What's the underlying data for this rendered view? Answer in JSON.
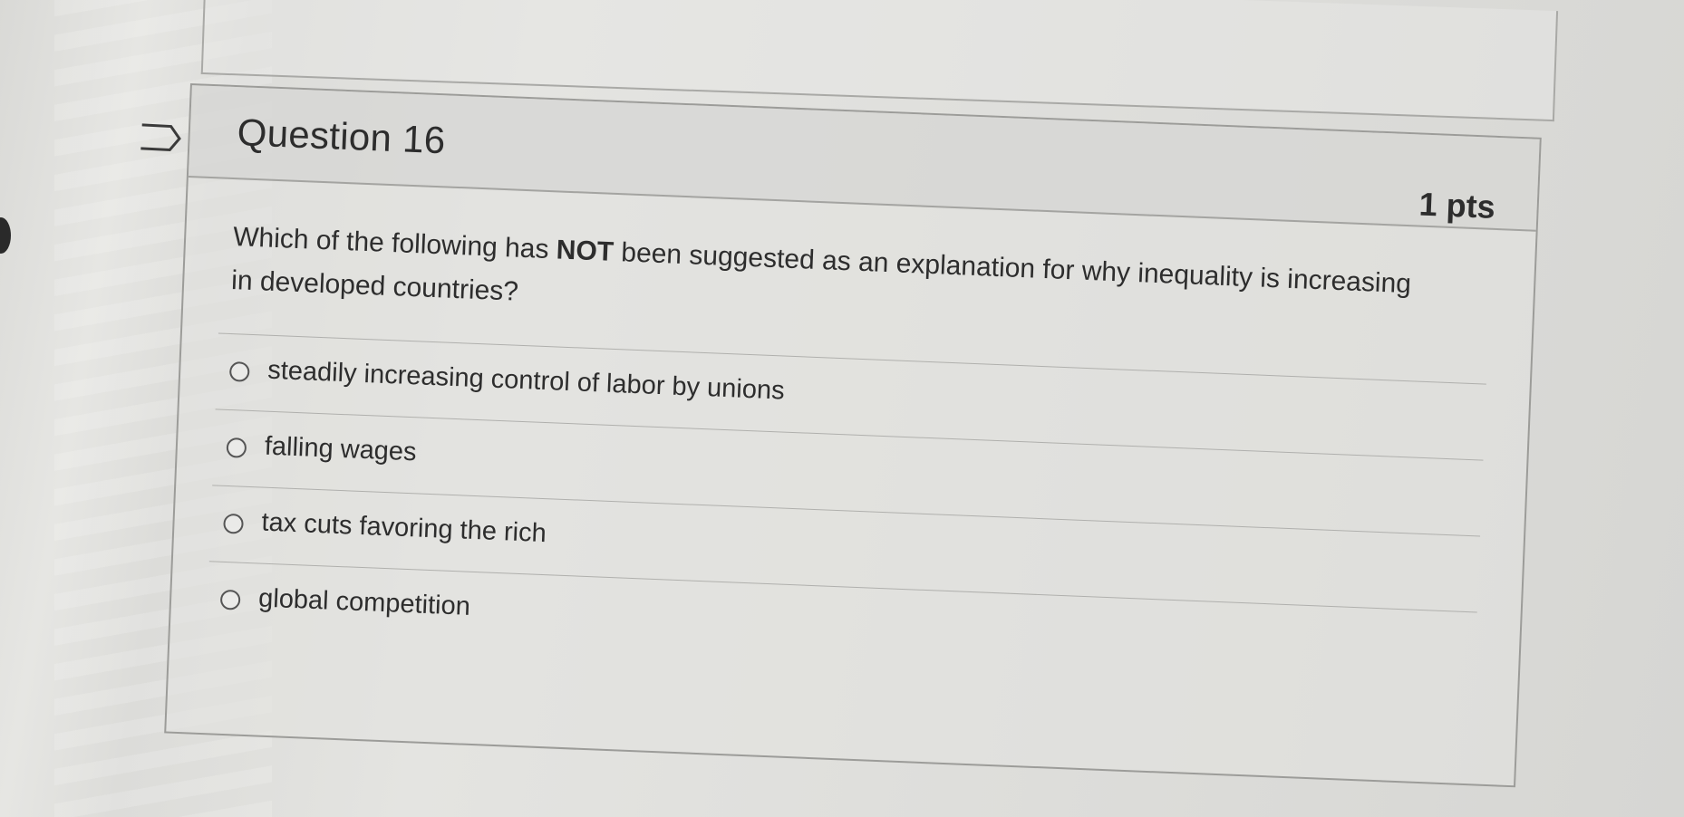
{
  "question": {
    "title": "Question 16",
    "points": "1 pts",
    "text_before": "Which of the following has ",
    "text_emphasis": "NOT",
    "text_after": " been suggested as an explanation for why inequality is increasing in developed countries?"
  },
  "answers": [
    {
      "label": "steadily increasing control of labor by unions"
    },
    {
      "label": "falling wages"
    },
    {
      "label": "tax cuts favoring the rich"
    },
    {
      "label": "global competition"
    }
  ],
  "icons": {
    "flag": "flag-question-icon",
    "radio": "radio-button-icon"
  }
}
